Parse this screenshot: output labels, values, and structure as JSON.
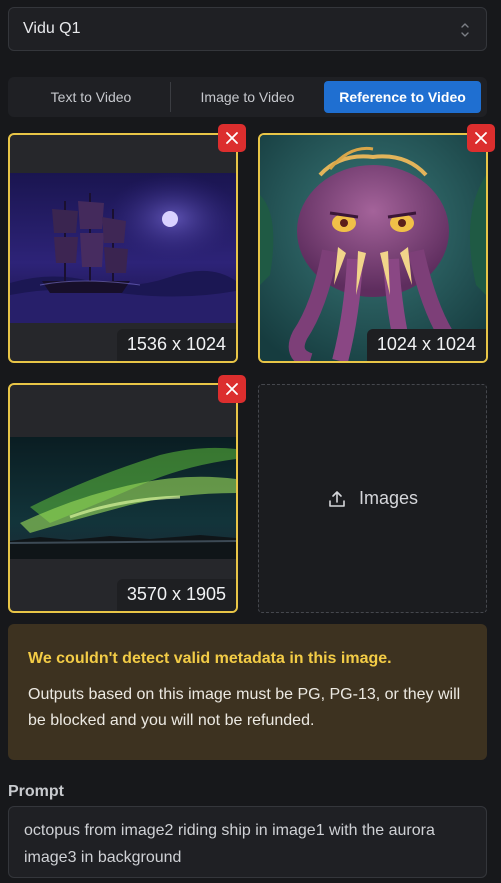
{
  "model_select": {
    "value": "Vidu Q1",
    "icon": "chevron-updown-icon"
  },
  "tabs": [
    {
      "label": "Text to Video",
      "active": false
    },
    {
      "label": "Image to Video",
      "active": false
    },
    {
      "label": "Reference to Video",
      "active": true
    }
  ],
  "references": [
    {
      "dimensions": "1536 x 1024",
      "subject": "ghost-ship-moonlit-sea"
    },
    {
      "dimensions": "1024 x 1024",
      "subject": "purple-octopus-monster"
    },
    {
      "dimensions": "3570 x 1905",
      "subject": "green-aurora-night-sky"
    }
  ],
  "upload": {
    "label": "Images",
    "icon": "upload-icon"
  },
  "warning": {
    "title": "We couldn't detect valid metadata in this image.",
    "body": "Outputs based on this image must be PG, PG-13, or they will be blocked and you will not be refunded."
  },
  "prompt": {
    "label": "Prompt",
    "value": "octopus from image2 riding ship in image1 with the aurora image3 in background"
  },
  "colors": {
    "active_tab": "#1f6fd1",
    "selected_border": "#e8c547",
    "remove_button": "#dc2e2e",
    "warning_bg": "#3d3220",
    "warning_title": "#f3cc46"
  }
}
